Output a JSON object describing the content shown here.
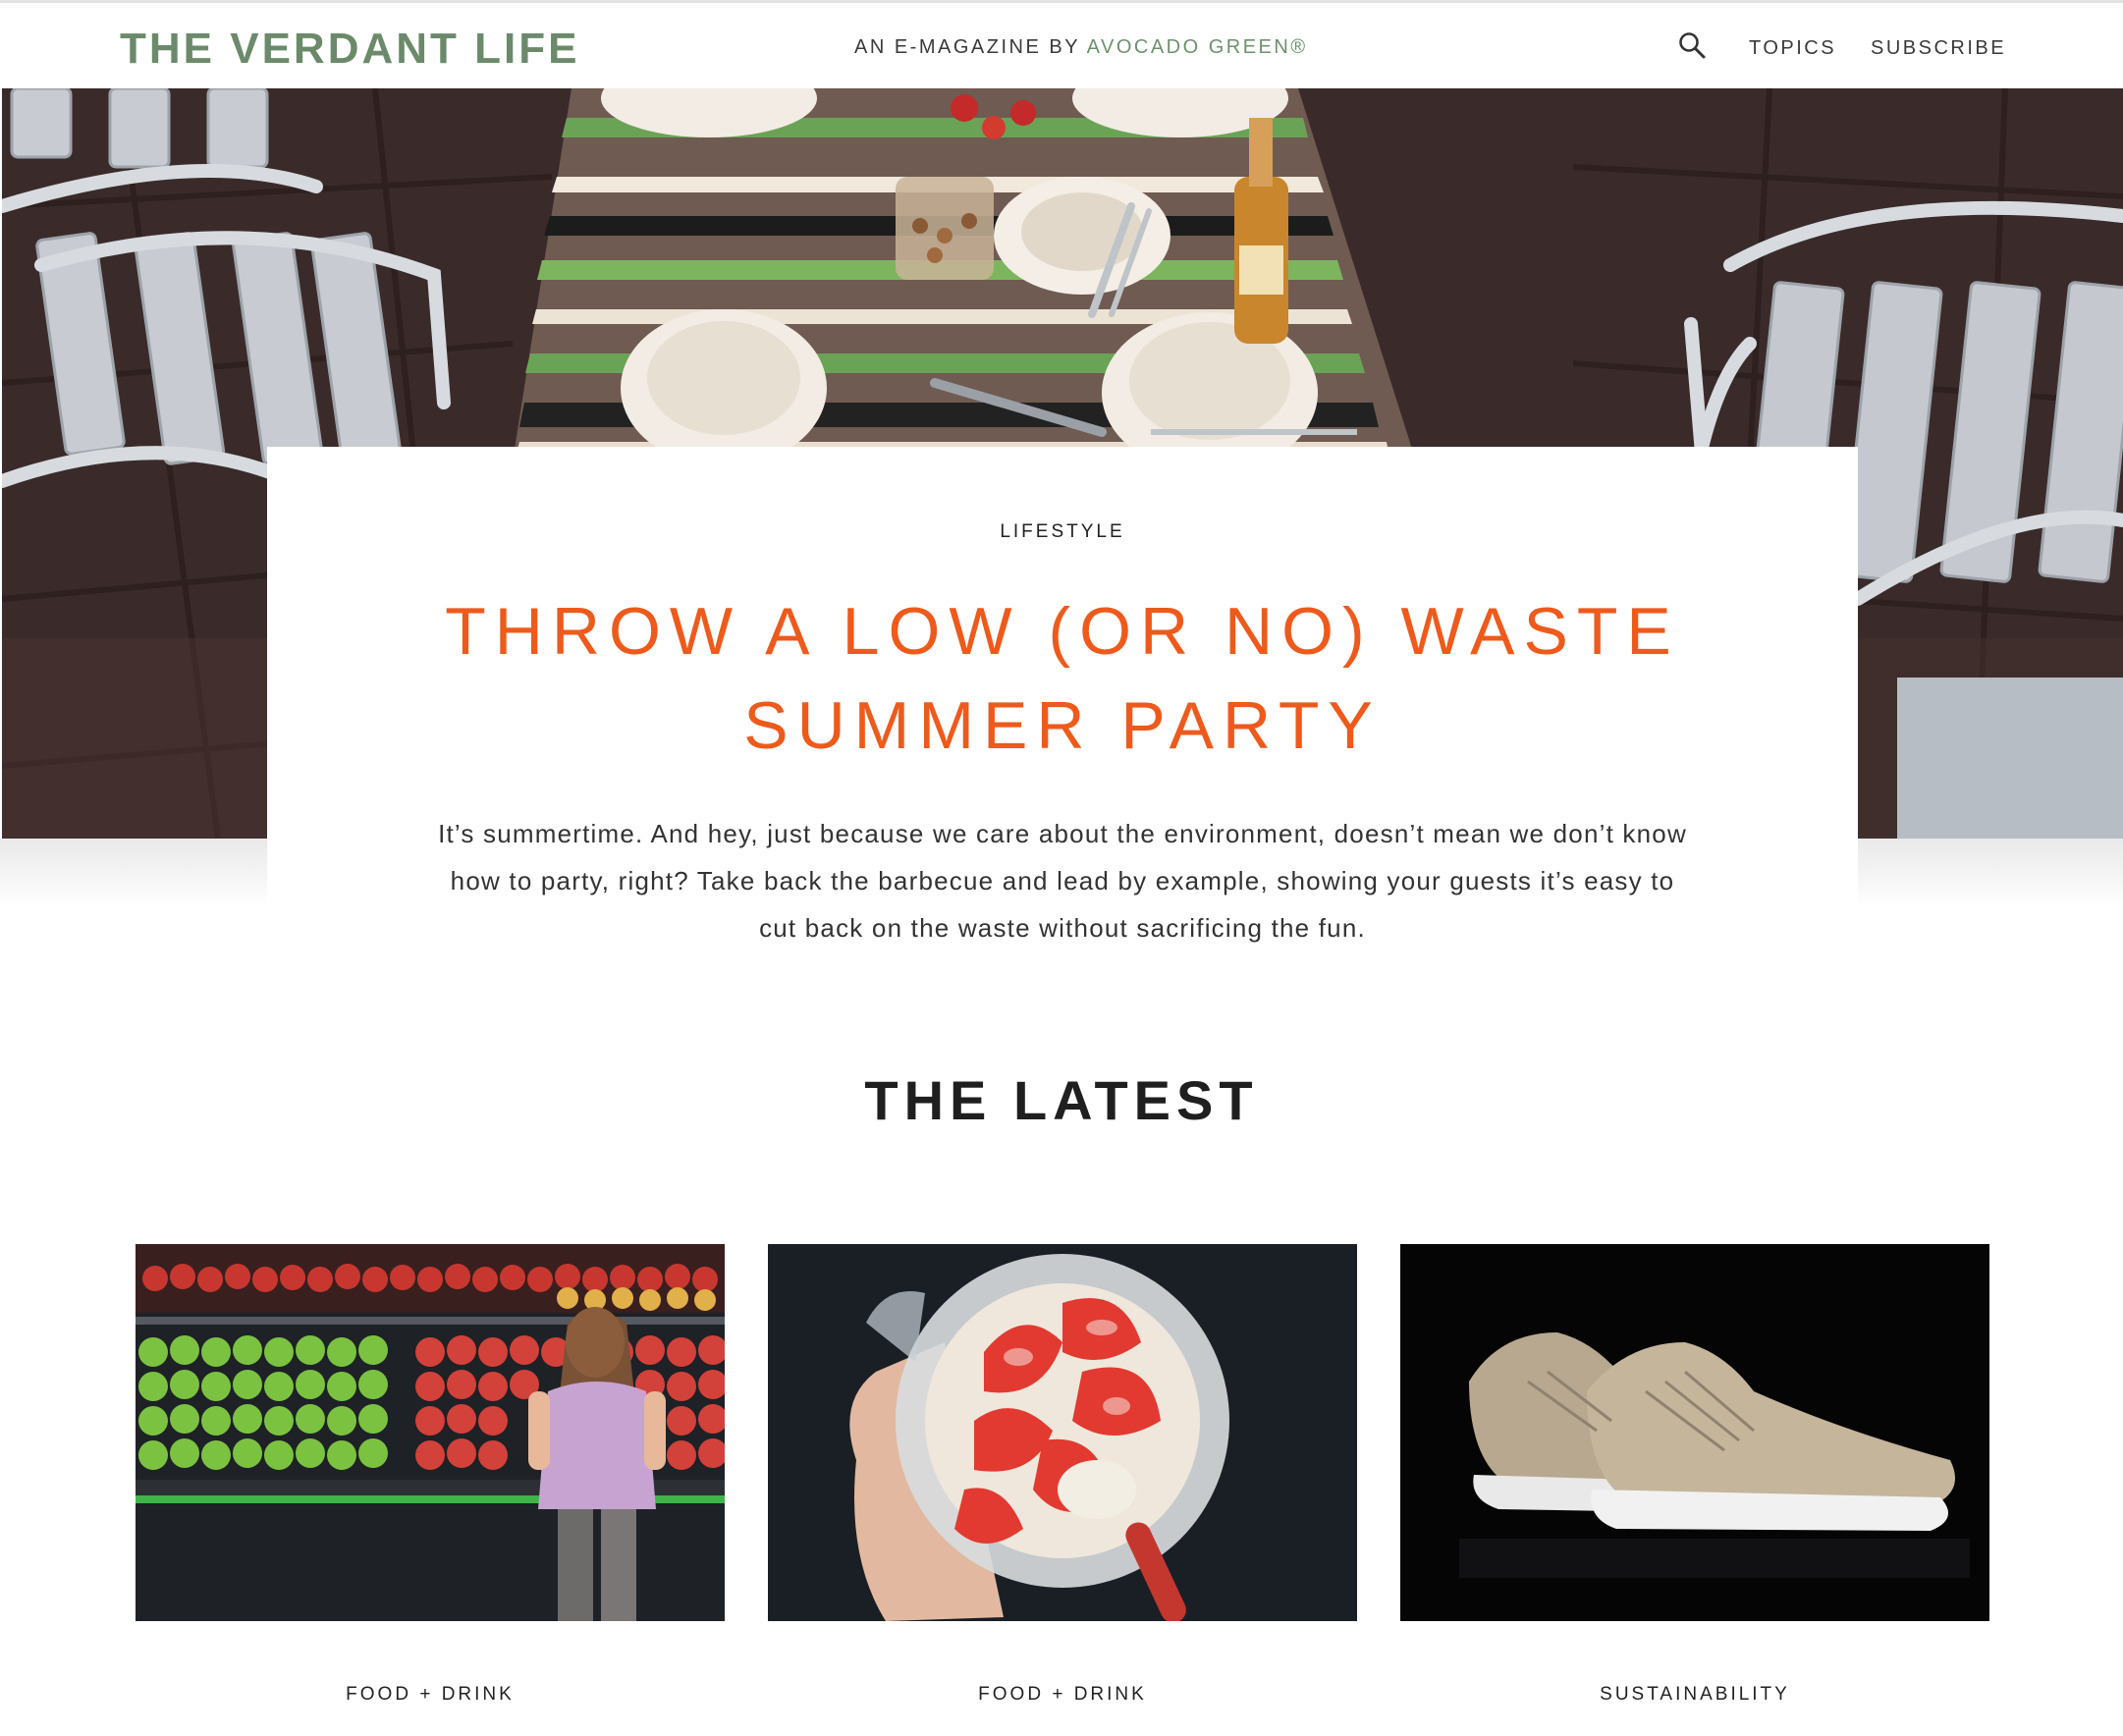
{
  "header": {
    "logo": "THE VERDANT LIFE",
    "tagline_prefix": "AN E-MAGAZINE BY ",
    "tagline_brand": "AVOCADO GREEN®",
    "nav": {
      "search_icon": "search-icon",
      "topics": "TOPICS",
      "subscribe": "SUBSCRIBE"
    }
  },
  "feature": {
    "category": "LIFESTYLE",
    "title": "THROW A LOW (OR NO) WASTE SUMMER PARTY",
    "excerpt": "It’s summertime. And hey, just because we care about the environment, doesn’t mean we don’t know how to party, right? Take back the barbecue and lead by example, showing your guests it’s easy to cut back on the waste without sacrificing the fun."
  },
  "latest": {
    "heading": "THE LATEST",
    "cards": [
      {
        "category": "FOOD + DRINK"
      },
      {
        "category": "FOOD + DRINK"
      },
      {
        "category": "SUSTAINABILITY"
      }
    ]
  },
  "colors": {
    "logo": "#6b8a6b",
    "brand_link": "#6f8f6f",
    "feature_title": "#ee5a1b",
    "text": "#222222"
  }
}
